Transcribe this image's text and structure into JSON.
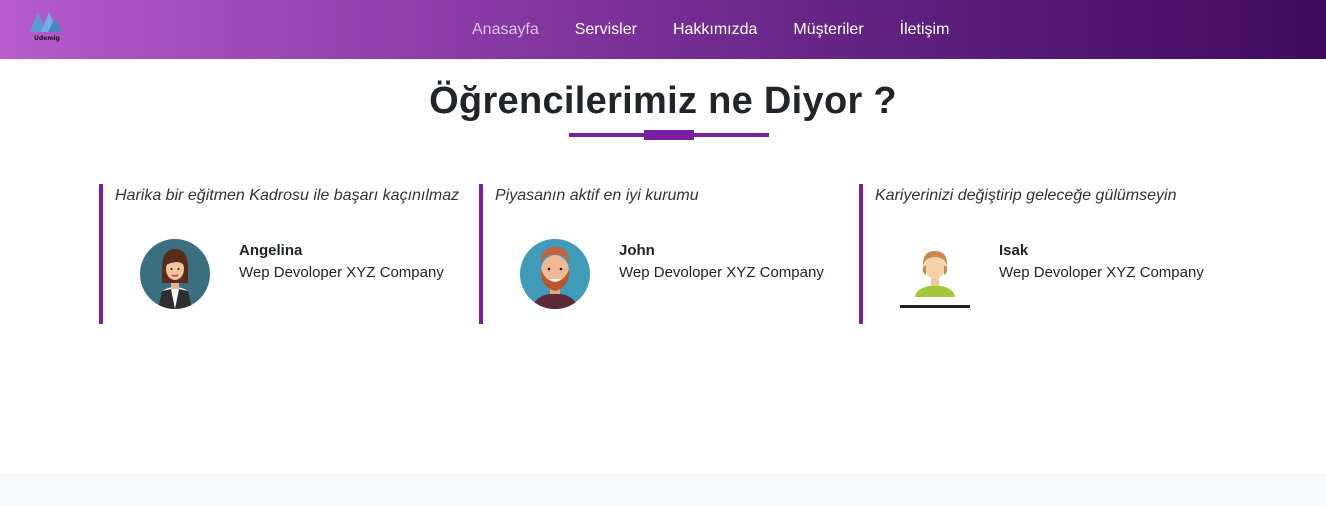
{
  "brand": {
    "logo_text": "Udemig"
  },
  "nav": {
    "items": [
      {
        "label": "Anasayfa",
        "active": true
      },
      {
        "label": "Servisler",
        "active": false
      },
      {
        "label": "Hakkımızda",
        "active": false
      },
      {
        "label": "Müşteriler",
        "active": false
      },
      {
        "label": "İletişim",
        "active": false
      }
    ]
  },
  "section": {
    "title": "Öğrencilerimiz ne Diyor ?"
  },
  "testimonials": [
    {
      "quote": "Harika bir eğitmen Kadrosu ile başarı kaçınılmaz",
      "name": "Angelina",
      "role": "Wep Devoloper XYZ Company",
      "avatar": "woman-avatar-icon"
    },
    {
      "quote": "Piyasanın aktif en iyi kurumu",
      "name": "John",
      "role": "Wep Devoloper XYZ Company",
      "avatar": "bearded-man-avatar-icon"
    },
    {
      "quote": "Kariyerinizi değiştirip geleceğe gülümseyin",
      "name": "Isak",
      "role": "Wep Devoloper XYZ Company",
      "avatar": "user-avatar-icon"
    }
  ],
  "colors": {
    "accent": "#7b1fa2",
    "nav_gradient_start": "#b75bcd",
    "nav_gradient_end": "#3f0a5e"
  }
}
